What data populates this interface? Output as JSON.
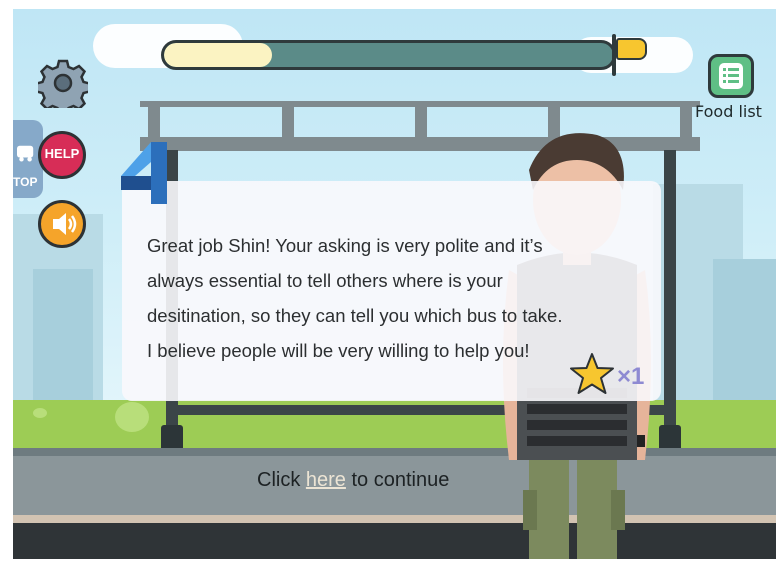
{
  "hud": {
    "progress": 0.24,
    "help_label": "HELP",
    "stop_label": "TOP",
    "food_list_label": "Food list"
  },
  "dialog": {
    "line1": "Great job Shin! Your asking is very polite and it’s",
    "line2": "always essential to tell others where is your",
    "line3": "desitination, so they can tell you which bus to take.",
    "line4": "I believe people will be very willing to help you!",
    "star_count": "×1"
  },
  "footer": {
    "before": "Click ",
    "link": "here",
    "after": " to continue"
  },
  "colors": {
    "progress_fill": "#fbf3c2",
    "progress_track": "#5b8b88",
    "help_red": "#d72d57",
    "sound_orange": "#f5a42a",
    "food_green": "#5fbf85",
    "star_yellow": "#f7c62f"
  },
  "icons": [
    "settings-gear-icon",
    "bus-stop-icon",
    "help-icon",
    "sound-icon",
    "food-list-icon",
    "flag-icon",
    "star-icon"
  ]
}
